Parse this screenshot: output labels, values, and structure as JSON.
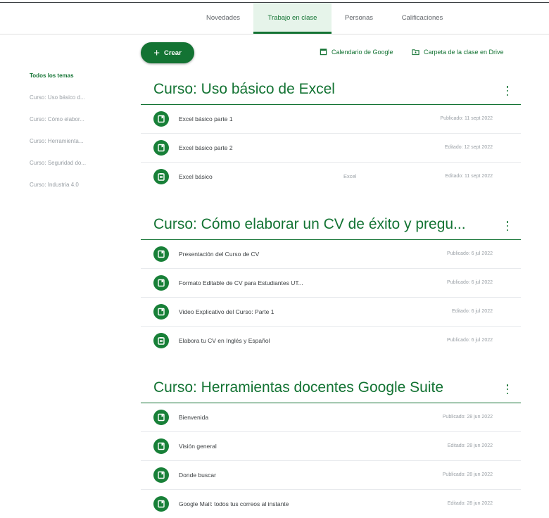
{
  "tabs": [
    {
      "label": "Novedades",
      "active": false
    },
    {
      "label": "Trabajo en clase",
      "active": true
    },
    {
      "label": "Personas",
      "active": false
    },
    {
      "label": "Calificaciones",
      "active": false
    }
  ],
  "toolbar": {
    "create_label": "Crear",
    "calendar_label": "Calendario de Google",
    "drive_label": "Carpeta de la clase en Drive"
  },
  "sidebar": {
    "items": [
      {
        "label": "Todos los temas",
        "active": true
      },
      {
        "label": "Curso: Uso básico d...",
        "active": false
      },
      {
        "label": "Curso: Cómo elabor...",
        "active": false
      },
      {
        "label": "Curso: Herramienta...",
        "active": false
      },
      {
        "label": "Curso: Seguridad do...",
        "active": false
      },
      {
        "label": "Curso: Industria 4.0",
        "active": false
      }
    ]
  },
  "topics": [
    {
      "title": "Curso: Uso básico de Excel",
      "items": [
        {
          "icon": "material-icon",
          "title": "Excel básico parte 1",
          "mid": "",
          "status": "Publicado: 11 sept 2022"
        },
        {
          "icon": "material-icon",
          "title": "Excel básico parte 2",
          "mid": "",
          "status": "Editado: 12 sept 2022"
        },
        {
          "icon": "assignment-icon",
          "title": "Excel básico",
          "mid": "Excel",
          "status": "Editado: 11 sept 2022"
        }
      ]
    },
    {
      "title": "Curso: Cómo elaborar un CV de éxito y pregu...",
      "items": [
        {
          "icon": "material-icon",
          "title": "Presentación del Curso de CV",
          "mid": "",
          "status": "Publicado: 6 jul 2022"
        },
        {
          "icon": "material-icon",
          "title": "Formato Editable de CV para Estudiantes UT...",
          "mid": "",
          "status": "Publicado: 6 jul 2022"
        },
        {
          "icon": "material-icon",
          "title": "Video Explicativo del Curso: Parte 1",
          "mid": "",
          "status": "Editado: 6 jul 2022"
        },
        {
          "icon": "assignment-icon",
          "title": "Elabora tu CV en Inglés y Español",
          "mid": "",
          "status": "Publicado: 6 jul 2022"
        }
      ]
    },
    {
      "title": "Curso: Herramientas docentes Google Suite",
      "items": [
        {
          "icon": "material-icon",
          "title": "Bienvenida",
          "mid": "",
          "status": "Publicado: 28 jun 2022"
        },
        {
          "icon": "material-icon",
          "title": "Visión general",
          "mid": "",
          "status": "Editado: 28 jun 2022"
        },
        {
          "icon": "material-icon",
          "title": "Donde buscar",
          "mid": "",
          "status": "Publicado: 28 jun 2022"
        },
        {
          "icon": "material-icon",
          "title": "Google Mail: todos tus correos al instante",
          "mid": "",
          "status": "Editado: 28 jun 2022"
        }
      ]
    }
  ],
  "colors": {
    "accent": "#137333",
    "icon_bg": "#188038",
    "tab_active_bg": "#e6f4ea"
  }
}
